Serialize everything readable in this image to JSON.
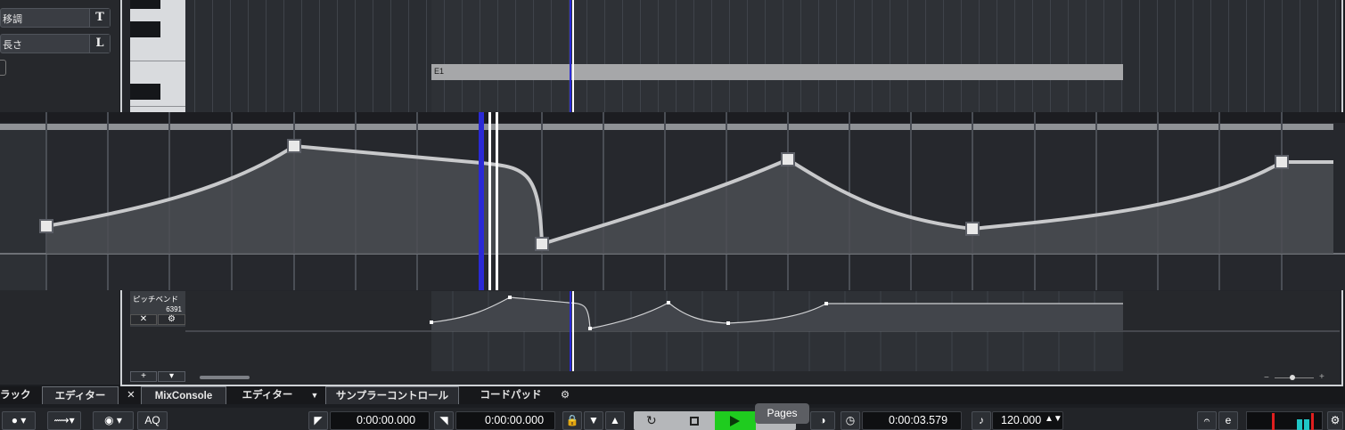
{
  "inspector": {
    "transpose_label": "移調",
    "transpose_key": "T",
    "length_label": "長さ",
    "length_key": "L"
  },
  "note": {
    "label": "E1"
  },
  "pitchbend": {
    "label": "ピッチベンド",
    "value": "6391"
  },
  "tabs": {
    "left_partial": "ラック",
    "left_editor": "エディター",
    "mixconsole": "MixConsole",
    "editor": "エディター",
    "sampler": "サンプラーコントロール",
    "chordpad": "コードパッド"
  },
  "transport": {
    "aq_label": "AQ",
    "left_locator": "0:00:00.000",
    "right_locator": "0:00:00.000",
    "position": "0:00:03.579",
    "tempo": "120.000",
    "tooltip": "Pages"
  },
  "icons": {
    "record": "record-icon",
    "waveform": "waveform-icon",
    "midi": "midi-icon",
    "lock": "lock-icon",
    "cycle": "cycle-icon",
    "stop": "stop-icon",
    "play": "play-icon",
    "clock": "clock-icon",
    "metronome": "metronome-icon",
    "settings": "gear-icon"
  },
  "colors": {
    "play_green": "#1fcc1f",
    "cursor_blue": "#2a29d6",
    "meter_red": "#e01f1f",
    "meter_cyan": "#1fc7c7"
  }
}
